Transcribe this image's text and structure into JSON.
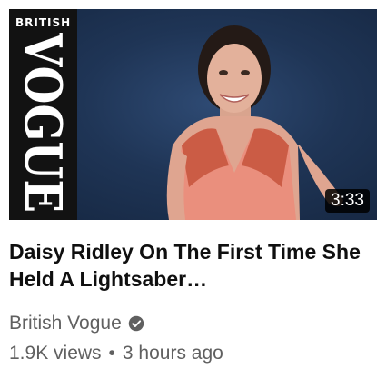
{
  "video": {
    "thumbnail": {
      "brand_top": "BRITISH",
      "brand_logo": "VOGUE",
      "duration": "3:33",
      "background_color": "#1f3556"
    },
    "title": "Daisy Ridley On The First Time She Held A Lightsaber…",
    "channel": {
      "name": "British Vogue",
      "verified_icon": "verified-check-icon"
    },
    "views": "1.9K views",
    "separator": "•",
    "age": "3 hours ago"
  }
}
